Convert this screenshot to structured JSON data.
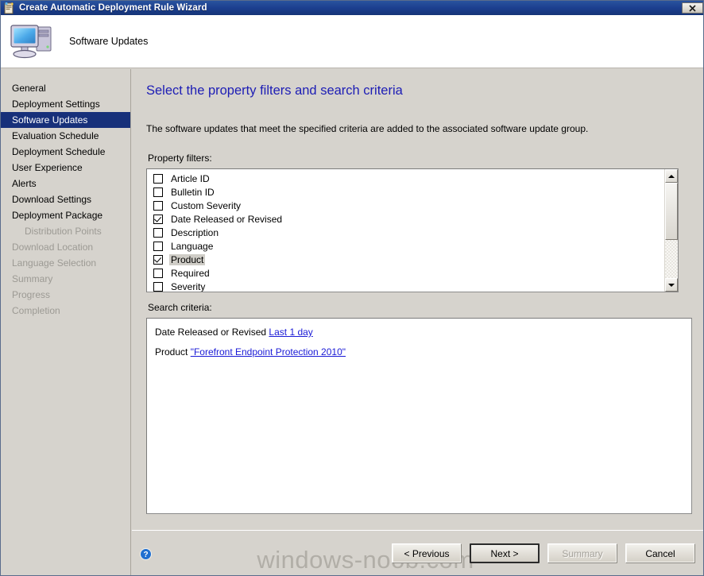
{
  "window": {
    "title": "Create Automatic Deployment Rule Wizard",
    "close_label": "×",
    "titlebar_color": "#1c3f8f"
  },
  "header": {
    "title": "Software Updates",
    "icon": "computer-monitor-icon"
  },
  "sidebar": {
    "items": [
      {
        "label": "General",
        "state": "enabled",
        "indent": false
      },
      {
        "label": "Deployment Settings",
        "state": "enabled",
        "indent": false
      },
      {
        "label": "Software Updates",
        "state": "selected",
        "indent": false
      },
      {
        "label": "Evaluation Schedule",
        "state": "enabled",
        "indent": false
      },
      {
        "label": "Deployment Schedule",
        "state": "enabled",
        "indent": false
      },
      {
        "label": "User Experience",
        "state": "enabled",
        "indent": false
      },
      {
        "label": "Alerts",
        "state": "enabled",
        "indent": false
      },
      {
        "label": "Download Settings",
        "state": "enabled",
        "indent": false
      },
      {
        "label": "Deployment Package",
        "state": "enabled",
        "indent": false
      },
      {
        "label": "Distribution Points",
        "state": "disabled",
        "indent": true
      },
      {
        "label": "Download Location",
        "state": "disabled",
        "indent": false
      },
      {
        "label": "Language Selection",
        "state": "disabled",
        "indent": false
      },
      {
        "label": "Summary",
        "state": "disabled",
        "indent": false
      },
      {
        "label": "Progress",
        "state": "disabled",
        "indent": false
      },
      {
        "label": "Completion",
        "state": "disabled",
        "indent": false
      }
    ]
  },
  "main": {
    "heading": "Select the property filters and search criteria",
    "heading_color": "#1d1db5",
    "description": "The software updates that meet the specified criteria are added to the associated software update group.",
    "property_filters_label": "Property filters:",
    "search_criteria_label": "Search criteria:",
    "property_filters": [
      {
        "label": "Article ID",
        "checked": false,
        "selected": false
      },
      {
        "label": "Bulletin ID",
        "checked": false,
        "selected": false
      },
      {
        "label": "Custom Severity",
        "checked": false,
        "selected": false
      },
      {
        "label": "Date Released or Revised",
        "checked": true,
        "selected": false
      },
      {
        "label": "Description",
        "checked": false,
        "selected": false
      },
      {
        "label": "Language",
        "checked": false,
        "selected": false
      },
      {
        "label": "Product",
        "checked": true,
        "selected": true
      },
      {
        "label": "Required",
        "checked": false,
        "selected": false
      },
      {
        "label": "Severity",
        "checked": false,
        "selected": false
      }
    ],
    "search_criteria": [
      {
        "prefix": "Date Released or Revised ",
        "link": "Last 1 day"
      },
      {
        "prefix": "Product ",
        "link": "\"Forefront Endpoint Protection 2010\""
      }
    ]
  },
  "footer": {
    "help_icon": "help-question-icon",
    "watermark": "windows-noob.com",
    "buttons": [
      {
        "label": "< Previous",
        "state": "enabled"
      },
      {
        "label": "Next >",
        "state": "default"
      },
      {
        "label": "Summary",
        "state": "disabled"
      },
      {
        "label": "Cancel",
        "state": "enabled"
      }
    ]
  }
}
